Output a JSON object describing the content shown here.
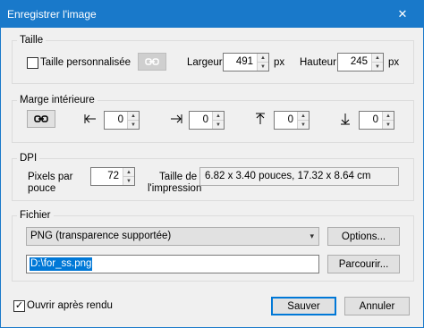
{
  "window": {
    "title": "Enregistrer l'image",
    "close_glyph": "✕"
  },
  "taille": {
    "group_label": "Taille",
    "custom_size_label": "Taille personnalisée",
    "custom_size_checked": false,
    "link_icon": "link-icon",
    "width_label": "Largeur",
    "width_value": "491",
    "width_unit": "px",
    "height_label": "Hauteur",
    "height_value": "245",
    "height_unit": "px"
  },
  "marge": {
    "group_label": "Marge intérieure",
    "link_icon": "link-icon",
    "left_value": "0",
    "right_value": "0",
    "top_value": "0",
    "bottom_value": "0",
    "left_icon": "arrow-left-from-bar-icon",
    "right_icon": "arrow-right-to-bar-icon",
    "top_icon": "arrow-up-to-bar-icon",
    "bottom_icon": "arrow-down-to-bar-icon"
  },
  "dpi": {
    "group_label": "DPI",
    "pixels_label_1": "Pixels par",
    "pixels_label_2": "pouce",
    "pixels_value": "72",
    "print_label_1": "Taille de",
    "print_label_2": "l'impression",
    "print_size": "6.82 x 3.40 pouces, 17.32 x 8.64 cm"
  },
  "fichier": {
    "group_label": "Fichier",
    "format_selected": "PNG (transparence supportée)",
    "options_button": "Options...",
    "path_value": "D:\\for_ss.png",
    "browse_button": "Parcourir..."
  },
  "footer": {
    "open_after_label": "Ouvrir après rendu",
    "open_after_checked": true,
    "check_glyph": "✓",
    "save_button": "Sauver",
    "cancel_button": "Annuler"
  },
  "glyphs": {
    "up": "▲",
    "down": "▼",
    "chevron": "▾"
  }
}
